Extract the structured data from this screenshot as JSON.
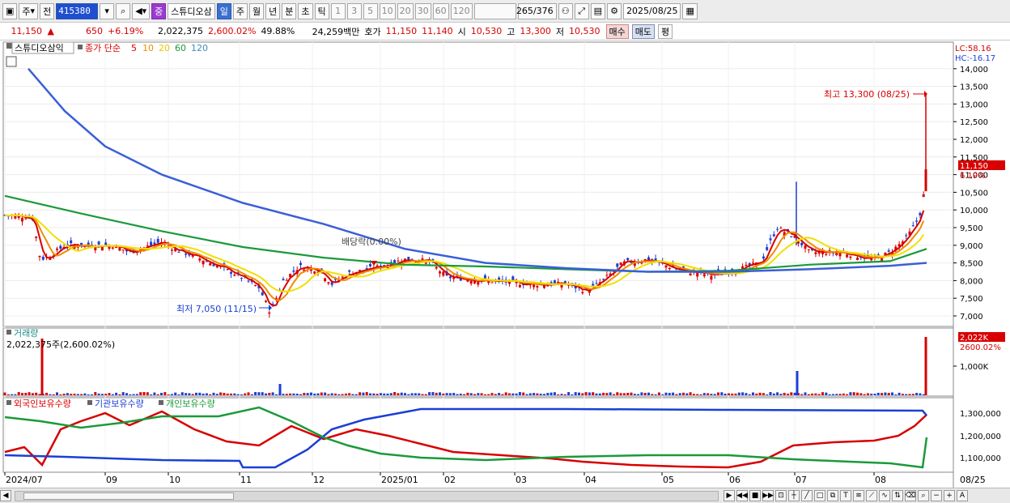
{
  "toolbar": {
    "market_label": "주",
    "prev_label": "전",
    "code": "415380",
    "mark_label": "중",
    "stock_name": "스튜디오삼",
    "periods": [
      "일",
      "주",
      "월",
      "년",
      "분",
      "초",
      "틱"
    ],
    "selected_period": "일",
    "intervals": [
      "1",
      "3",
      "5",
      "10",
      "20",
      "30",
      "60",
      "120"
    ],
    "count": "265",
    "total": "376",
    "date": "2025/08/25"
  },
  "info": {
    "price": "11,150",
    "change": "650",
    "pct": "+6.19%",
    "volume": "2,022,375",
    "vol_ratio": "2,600.02%",
    "turnover": "49.88%",
    "amount": "24,259백만",
    "bid_label": "호가",
    "ask": "11,150",
    "bid": "11,140",
    "open_label": "시",
    "open": "10,530",
    "high_label": "고",
    "high": "13,300",
    "low_label": "저",
    "low": "10,530",
    "buy_label": "매수",
    "sell_label": "매도",
    "avg_label": "평"
  },
  "price_panel": {
    "name_label": "스튜디오삼익",
    "legend_prefix": "종가 단순",
    "ma_labels": [
      "5",
      "10",
      "20",
      "60",
      "120"
    ],
    "lc": "LC:58.16",
    "hc": "HC:-16.17",
    "y_ticks": [
      "14,000",
      "13,500",
      "13,000",
      "12,500",
      "12,000",
      "11,500",
      "11,000",
      "10,500",
      "10,000",
      "9,500",
      "9,000",
      "8,500",
      "8,000",
      "7,500",
      "7,000"
    ],
    "last_price_tag": "11,150",
    "last_pct_tag": "6.19%",
    "high_annot": "최고 13,300 (08/25)",
    "low_annot": "최저 7,050 (11/15)",
    "div_annot": "배당락(0.00%)"
  },
  "volume_panel": {
    "title": "거래량",
    "value_label": "2,022,375주(2,600.02%)",
    "tag": "2,022K",
    "pct_tag": "2600.02%",
    "tick": "1,000K"
  },
  "holding_panel": {
    "legend": [
      "외국인보유수량",
      "기관보유수량",
      "개인보유수량"
    ],
    "ticks": [
      "1,300,000",
      "1,200,000",
      "1,100,000"
    ]
  },
  "x_axis": {
    "labels": [
      "2024/07",
      "09",
      "10",
      "11",
      "12",
      "2025/01",
      "02",
      "03",
      "04",
      "05",
      "06",
      "07",
      "08"
    ],
    "right_label": "08/25"
  },
  "colors": {
    "up": "#d80000",
    "down": "#1a3fd6",
    "ma5": "#d80000",
    "ma10": "#f08c00",
    "ma20": "#f0e000",
    "ma60": "#1a9a3a",
    "ma120": "#3a5fd8"
  }
}
